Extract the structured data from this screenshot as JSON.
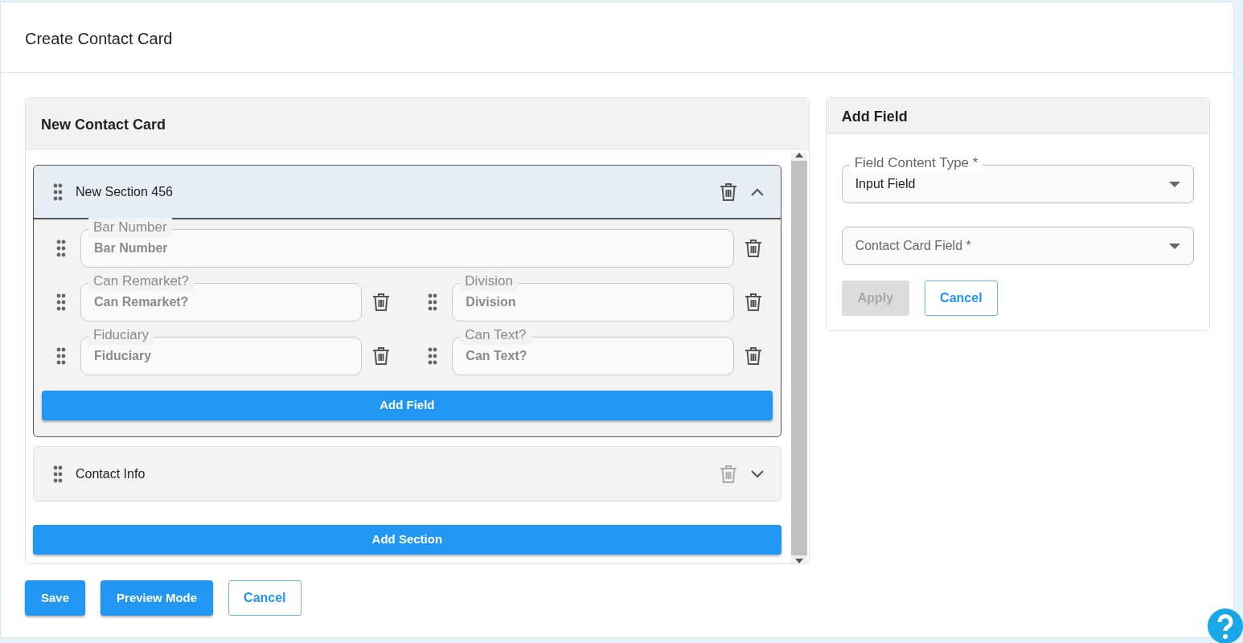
{
  "page": {
    "title": "Create Contact Card"
  },
  "card_editor": {
    "title": "New Contact Card",
    "sections": [
      {
        "name": "New Section 456",
        "expanded": true,
        "delete_enabled": true,
        "rows": [
          [
            {
              "label": "Bar Number",
              "placeholder": "Bar Number"
            }
          ],
          [
            {
              "label": "Can Remarket?",
              "placeholder": "Can Remarket?"
            },
            {
              "label": "Division",
              "placeholder": "Division"
            }
          ],
          [
            {
              "label": "Fiduciary",
              "placeholder": "Fiduciary"
            },
            {
              "label": "Can Text?",
              "placeholder": "Can Text?"
            }
          ]
        ],
        "add_button": "Add Field"
      },
      {
        "name": "Contact Info",
        "expanded": false,
        "delete_enabled": false
      }
    ],
    "add_section_button": "Add Section"
  },
  "add_field_panel": {
    "title": "Add Field",
    "fields": [
      {
        "label": "Field Content Type *",
        "value": "Input Field"
      },
      {
        "label": "Contact Card Field *"
      }
    ],
    "buttons": [
      {
        "label": "Apply",
        "kind": "primary",
        "disabled": true
      },
      {
        "label": "Cancel",
        "kind": "outline",
        "disabled": false
      }
    ]
  },
  "footer_buttons": [
    {
      "label": "Save",
      "kind": "primary"
    },
    {
      "label": "Preview Mode",
      "kind": "primary"
    },
    {
      "label": "Cancel",
      "kind": "outline"
    }
  ]
}
